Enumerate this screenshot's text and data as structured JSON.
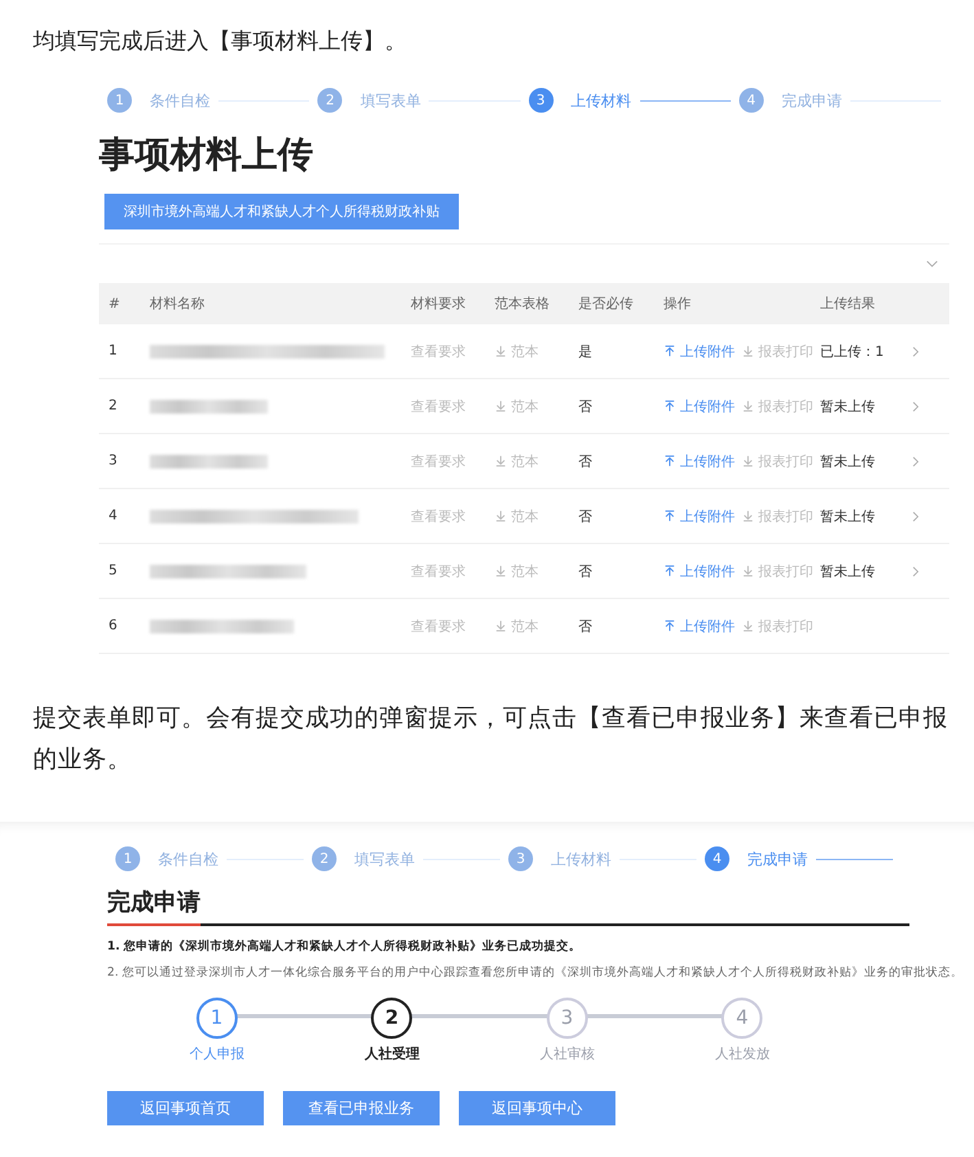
{
  "intro": "均填写完成后进入【事项材料上传】。",
  "upload_screen": {
    "steps": [
      {
        "number": "1",
        "label": "条件自检",
        "selected": false
      },
      {
        "number": "2",
        "label": "填写表单",
        "selected": false
      },
      {
        "number": "3",
        "label": "上传材料",
        "selected": true
      },
      {
        "number": "4",
        "label": "完成申请",
        "selected": false
      }
    ],
    "title": "事项材料上传",
    "tag": "深圳市境外高端人才和紧缺人才个人所得税财政补贴",
    "table": {
      "columns": [
        "#",
        "材料名称",
        "材料要求",
        "范本表格",
        "是否必传",
        "操作",
        "上传结果"
      ],
      "rows": [
        {
          "index": "1",
          "requirement": "查看要求",
          "template": "范本",
          "required": "是",
          "upload": "上传附件",
          "print": "报表打印",
          "result": "已上传：1"
        },
        {
          "index": "2",
          "requirement": "查看要求",
          "template": "范本",
          "required": "否",
          "upload": "上传附件",
          "print": "报表打印",
          "result": "暂未上传"
        },
        {
          "index": "3",
          "requirement": "查看要求",
          "template": "范本",
          "required": "否",
          "upload": "上传附件",
          "print": "报表打印",
          "result": "暂未上传"
        },
        {
          "index": "4",
          "requirement": "查看要求",
          "template": "范本",
          "required": "否",
          "upload": "上传附件",
          "print": "报表打印",
          "result": "暂未上传"
        },
        {
          "index": "5",
          "requirement": "查看要求",
          "template": "范本",
          "required": "否",
          "upload": "上传附件",
          "print": "报表打印",
          "result": "暂未上传"
        },
        {
          "index": "6",
          "requirement": "查看要求",
          "template": "范本",
          "required": "否",
          "upload": "上传附件",
          "print": "报表打印",
          "result": ""
        }
      ]
    }
  },
  "middle_text": "提交表单即可。会有提交成功的弹窗提示，可点击【查看已申报业务】来查看已申报的业务。",
  "finish_screen": {
    "steps": [
      {
        "number": "1",
        "label": "条件自检",
        "selected": false
      },
      {
        "number": "2",
        "label": "填写表单",
        "selected": false
      },
      {
        "number": "3",
        "label": "上传材料",
        "selected": false
      },
      {
        "number": "4",
        "label": "完成申请",
        "selected": true
      }
    ],
    "title": "完成申请",
    "notes": [
      "1. 您申请的《深圳市境外高端人才和紧缺人才个人所得税财政补贴》业务已成功提交。",
      "2. 您可以通过登录深圳市人才一体化综合服务平台的用户中心跟踪查看您所申请的《深圳市境外高端人才和紧缺人才个人所得税财政补贴》业务的审批状态。"
    ],
    "progress": [
      {
        "number": "1",
        "label": "个人申报",
        "done": true,
        "selected": false
      },
      {
        "number": "2",
        "label": "人社受理",
        "done": false,
        "selected": true
      },
      {
        "number": "3",
        "label": "人社审核",
        "done": false,
        "selected": false
      },
      {
        "number": "4",
        "label": "人社发放",
        "done": false,
        "selected": false
      }
    ],
    "buttons": [
      "返回事项首页",
      "查看已申报业务",
      "返回事项中心"
    ]
  }
}
